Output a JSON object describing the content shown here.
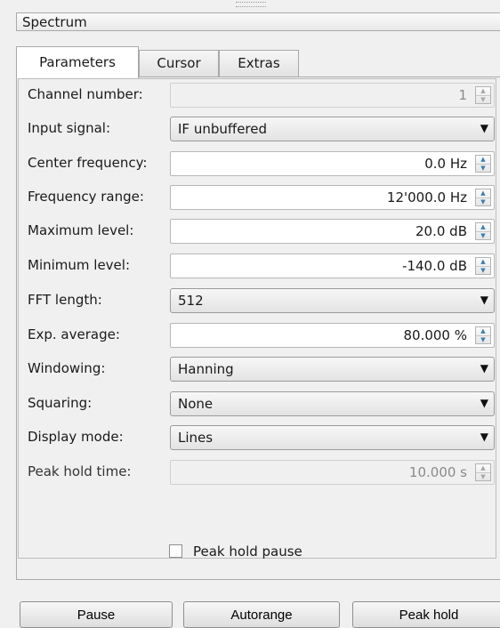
{
  "dock": {
    "title": "Spectrum"
  },
  "tabs": [
    {
      "label": "Parameters"
    },
    {
      "label": "Cursor"
    },
    {
      "label": "Extras"
    }
  ],
  "params": {
    "channel_number": {
      "label": "Channel number:",
      "value": "1"
    },
    "input_signal": {
      "label": "Input signal:",
      "value": "IF unbuffered"
    },
    "center_frequency": {
      "label": "Center frequency:",
      "value": "0.0 Hz"
    },
    "frequency_range": {
      "label": "Frequency range:",
      "value": "12'000.0 Hz"
    },
    "maximum_level": {
      "label": "Maximum level:",
      "value": "20.0 dB"
    },
    "minimum_level": {
      "label": "Minimum level:",
      "value": "-140.0 dB"
    },
    "fft_length": {
      "label": "FFT length:",
      "value": "512"
    },
    "exp_average": {
      "label": "Exp. average:",
      "value": "80.000 %"
    },
    "windowing": {
      "label": "Windowing:",
      "value": "Hanning"
    },
    "squaring": {
      "label": "Squaring:",
      "value": "None"
    },
    "display_mode": {
      "label": "Display mode:",
      "value": "Lines"
    },
    "peak_hold_time": {
      "label": "Peak hold time:",
      "value": "10.000 s"
    },
    "peak_hold_pause": {
      "label": "Peak hold pause",
      "checked": false
    }
  },
  "buttons": {
    "pause": "Pause",
    "autorange": "Autorange",
    "peak_hold": "Peak hold"
  },
  "icons": {
    "spin_up": "▲",
    "spin_down": "▼",
    "dropdown": "▼"
  }
}
